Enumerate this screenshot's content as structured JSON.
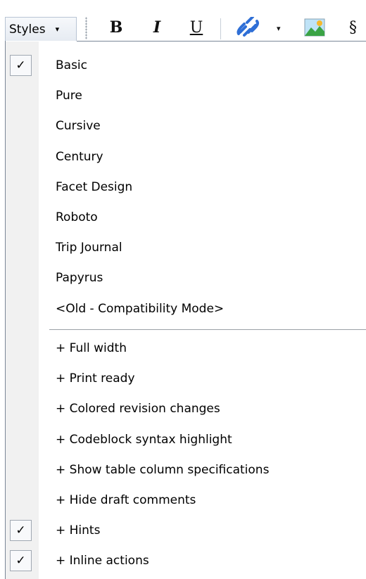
{
  "toolbar": {
    "styles_label": "Styles",
    "styles_caret": "▾",
    "bold_label": "B",
    "italic_label": "I",
    "underline_label": "U",
    "link_caret": "▾",
    "section_label": "§"
  },
  "colors": {
    "link_icon": "#2f6fd6",
    "image_icon_sky": "#bfe3f7",
    "image_icon_hill": "#3aa345",
    "image_icon_sun": "#f5b82e"
  },
  "menu": {
    "check_glyph": "✓",
    "styles": [
      {
        "label": "Basic",
        "checked": true
      },
      {
        "label": "Pure",
        "checked": false
      },
      {
        "label": "Cursive",
        "checked": false
      },
      {
        "label": "Century",
        "checked": false
      },
      {
        "label": "Facet Design",
        "checked": false
      },
      {
        "label": "Roboto",
        "checked": false
      },
      {
        "label": "Trip Journal",
        "checked": false
      },
      {
        "label": "Papyrus",
        "checked": false
      },
      {
        "label": "<Old - Compatibility Mode>",
        "checked": false
      }
    ],
    "options": [
      {
        "label": "+ Full width",
        "checked": false
      },
      {
        "label": "+ Print ready",
        "checked": false
      },
      {
        "label": "+ Colored revision changes",
        "checked": false
      },
      {
        "label": "+ Codeblock syntax highlight",
        "checked": false
      },
      {
        "label": "+ Show table column specifications",
        "checked": false
      },
      {
        "label": "+ Hide draft comments",
        "checked": false
      },
      {
        "label": "+ Hints",
        "checked": true
      },
      {
        "label": "+ Inline actions",
        "checked": true
      }
    ]
  }
}
